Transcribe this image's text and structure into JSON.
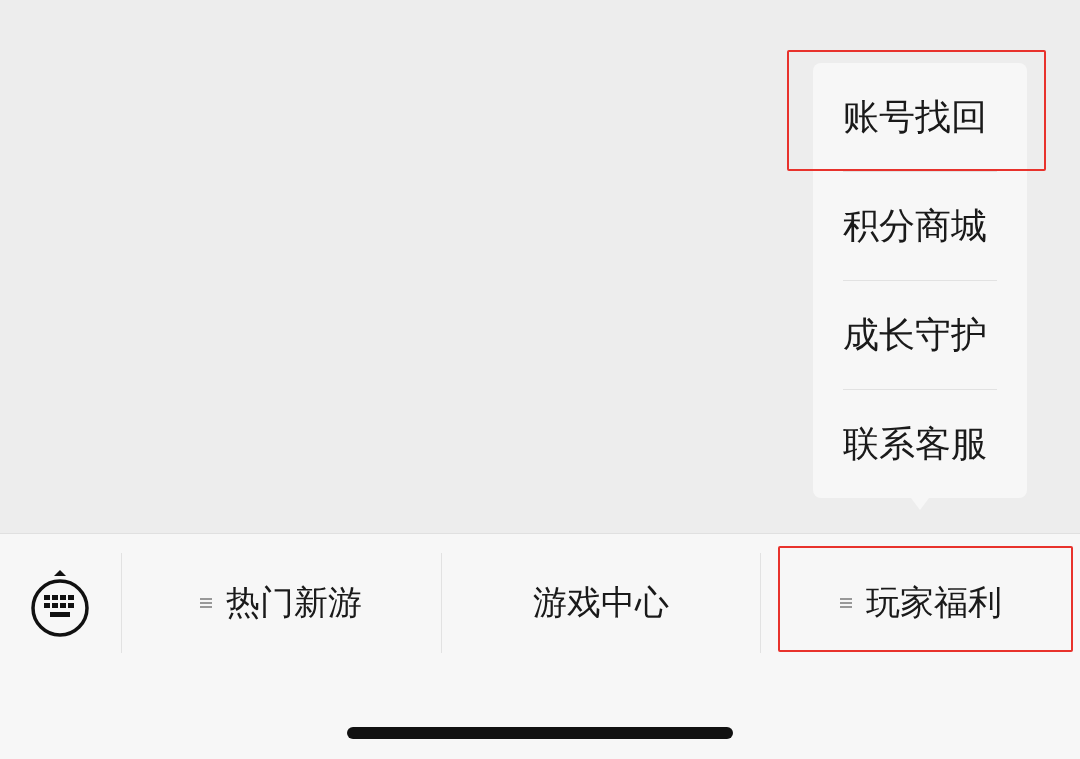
{
  "popup_menu": {
    "items": [
      {
        "label": "账号找回",
        "highlighted": true
      },
      {
        "label": "积分商城",
        "highlighted": false
      },
      {
        "label": "成长守护",
        "highlighted": false
      },
      {
        "label": "联系客服",
        "highlighted": false
      }
    ]
  },
  "bottom_menu": {
    "items": [
      {
        "label": "热门新游",
        "submenu": true,
        "highlighted": false
      },
      {
        "label": "游戏中心",
        "submenu": false,
        "highlighted": false
      },
      {
        "label": "玩家福利",
        "submenu": true,
        "highlighted": true
      }
    ]
  }
}
